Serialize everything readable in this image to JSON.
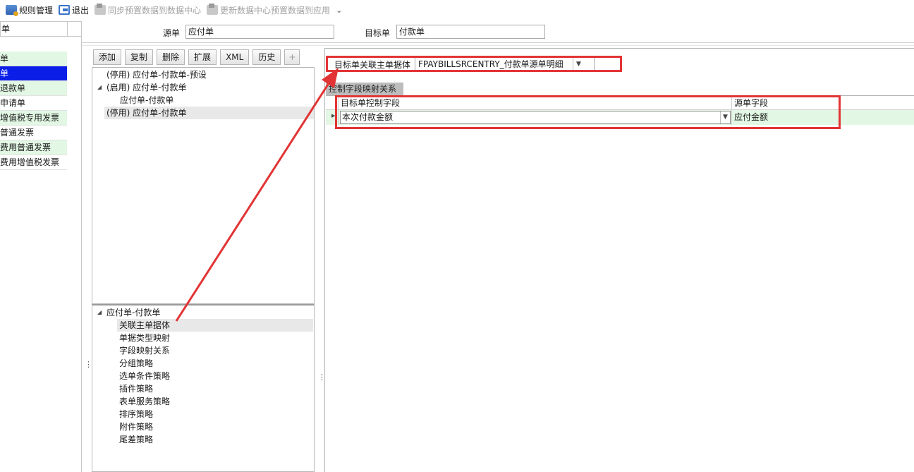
{
  "toolbar": {
    "rules_label": "规则管理",
    "exit_label": "退出",
    "sync_label": "同步预置数据到数据中心",
    "update_label": "更新数据中心预置数据到应用",
    "more_glyph": "⌄"
  },
  "left_list": {
    "header": "单",
    "items": [
      {
        "label": "单",
        "state": "alt"
      },
      {
        "label": "单",
        "state": "selected"
      },
      {
        "label": "退款单",
        "state": "alt"
      },
      {
        "label": "申请单",
        "state": "normal"
      },
      {
        "label": "增值税专用发票",
        "state": "alt"
      },
      {
        "label": "普通发票",
        "state": "normal"
      },
      {
        "label": "费用普通发票",
        "state": "alt"
      },
      {
        "label": "费用增值税发票",
        "state": "normal"
      }
    ]
  },
  "source": {
    "label": "源单",
    "value": "应付单"
  },
  "target": {
    "label": "目标单",
    "value": "付款单"
  },
  "mid_buttons": {
    "add": "添加",
    "copy": "复制",
    "delete": "删除",
    "extend": "扩展",
    "xml": "XML",
    "history": "历史",
    "plus": "+"
  },
  "rule_tree": [
    {
      "label": "(停用) 应付单-付款单-预设",
      "expander": ""
    },
    {
      "label": "(启用) 应付单-付款单",
      "expander": "◢"
    },
    {
      "label": "应付单-付款单",
      "expander": ""
    },
    {
      "label": "(停用) 应付单-付款单",
      "expander": ""
    }
  ],
  "strategy_tree": {
    "root": "应付单-付款单",
    "root_expander": "◢",
    "items": [
      "关联主单据体",
      "单据类型映射",
      "字段映射关系",
      "分组策略",
      "选单条件策略",
      "插件策略",
      "表单服务策略",
      "排序策略",
      "附件策略",
      "尾差策略"
    ]
  },
  "assoc": {
    "label": "目标单关联主单据体",
    "value": "FPAYBILLSRCENTRY_付款单源单明细",
    "arrow": "▼"
  },
  "mapping_tab": {
    "title": "控制字段映射关系"
  },
  "mapping_grid": {
    "headers": [
      "目标单控制字段",
      "源单字段"
    ],
    "rows": [
      {
        "target_field": "本次付款金额",
        "source_field": "应付金额"
      }
    ],
    "row_indicator": "▶",
    "arrow": "▼"
  },
  "splitter_glyph": "⋮",
  "colors": {
    "selection": "#0a1ee8",
    "alt_row": "#e2f7e4",
    "annotation": "#e23434"
  }
}
